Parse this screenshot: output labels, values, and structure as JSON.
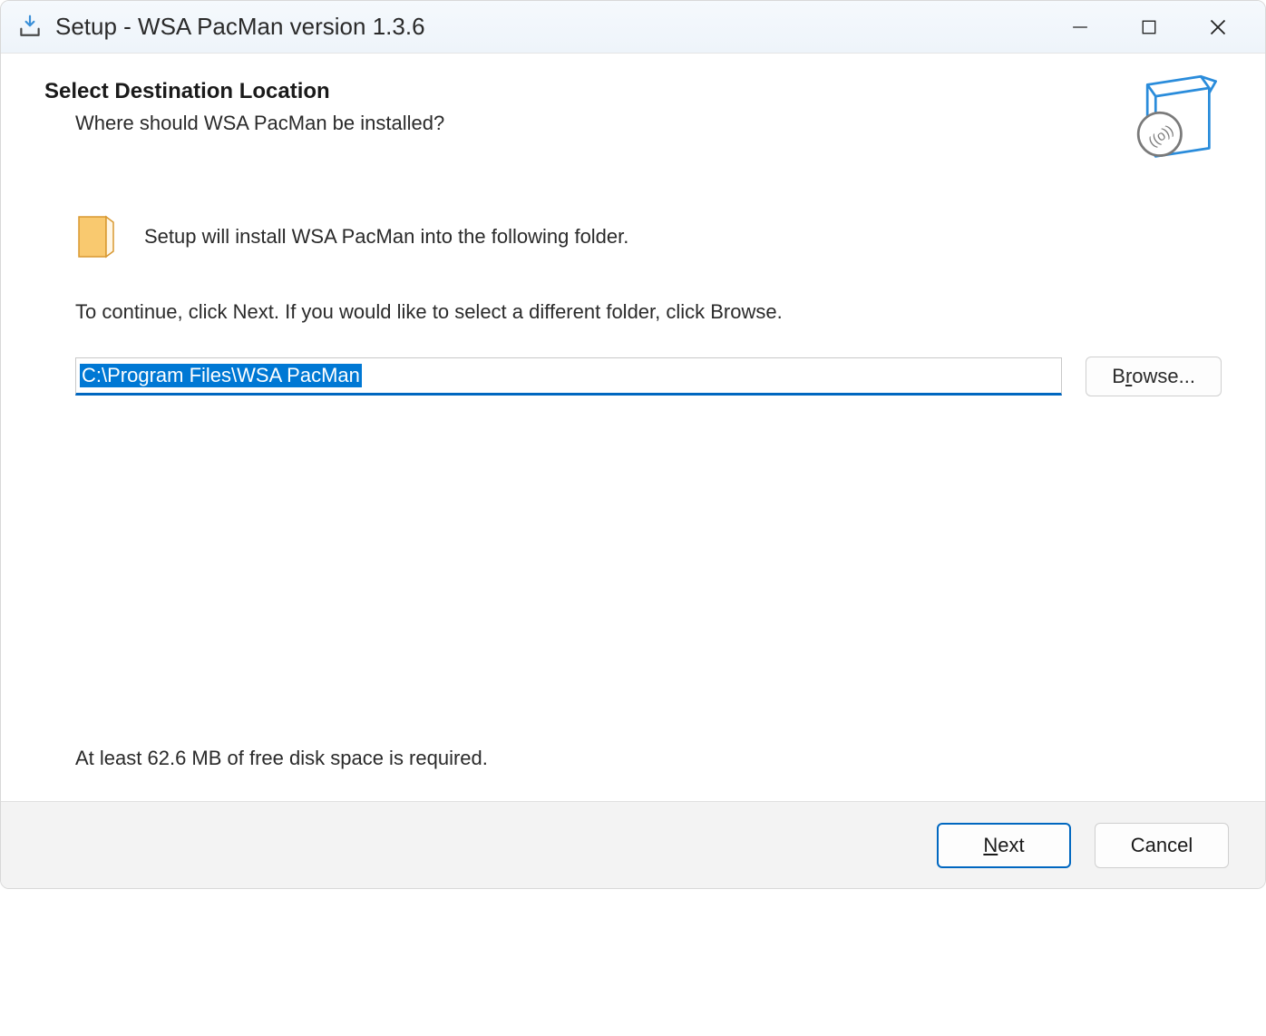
{
  "titlebar": {
    "title": "Setup - WSA PacMan version 1.3.6"
  },
  "header": {
    "title": "Select Destination Location",
    "subtitle": "Where should WSA PacMan be installed?"
  },
  "body": {
    "intro": "Setup will install WSA PacMan into the following folder.",
    "instruction": "To continue, click Next. If you would like to select a different folder, click Browse.",
    "path": "C:\\Program Files\\WSA PacMan",
    "browse_label": "Browse...",
    "disk_space": "At least 62.6 MB of free disk space is required."
  },
  "footer": {
    "next": "Next",
    "cancel": "Cancel"
  }
}
